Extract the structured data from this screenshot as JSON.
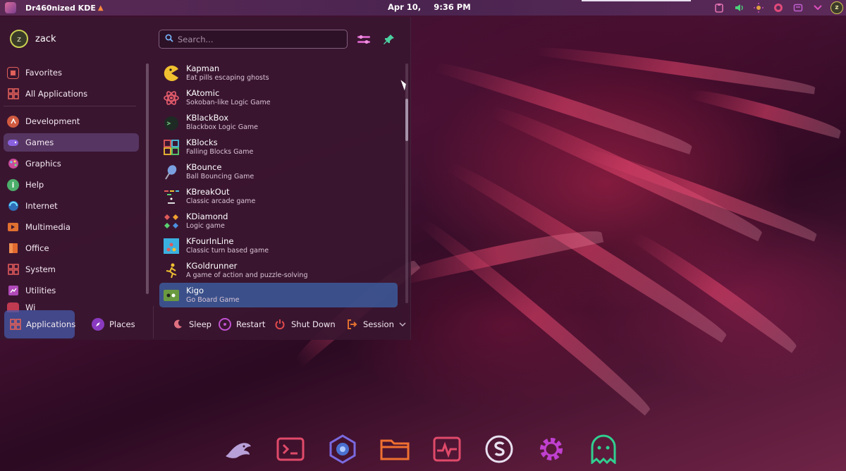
{
  "top_panel": {
    "title": "Dr460nized KDE",
    "date": "Apr 10,",
    "time": "9:36 PM",
    "avatar_initial": "z"
  },
  "menu": {
    "user": {
      "initial": "z",
      "name": "zack"
    },
    "search": {
      "placeholder": "Search...",
      "value": ""
    },
    "categories": [
      {
        "label": "Favorites",
        "icon": "star-icon",
        "color": "#e0605a"
      },
      {
        "label": "All Applications",
        "icon": "grid-icon",
        "color": "#e0605a"
      },
      {
        "label": "Development",
        "icon": "development-icon",
        "color": "#d05a40"
      },
      {
        "label": "Games",
        "icon": "games-icon",
        "color": "#7b5cd6"
      },
      {
        "label": "Graphics",
        "icon": "graphics-icon",
        "color": "#c84a9a"
      },
      {
        "label": "Help",
        "icon": "help-icon",
        "color": "#4cae6a"
      },
      {
        "label": "Internet",
        "icon": "internet-icon",
        "color": "#3c8ed8"
      },
      {
        "label": "Multimedia",
        "icon": "multimedia-icon",
        "color": "#e07030"
      },
      {
        "label": "Office",
        "icon": "office-icon",
        "color": "#e06a30"
      },
      {
        "label": "System",
        "icon": "system-icon",
        "color": "#e05a5a"
      },
      {
        "label": "Utilities",
        "icon": "utilities-icon",
        "color": "#b04ab8"
      },
      {
        "label": "Wi",
        "icon": "wine-icon",
        "color": "#c03a50"
      }
    ],
    "apps": [
      {
        "name": "Kapman",
        "desc": "Eat pills escaping ghosts",
        "icon": "kapman-icon"
      },
      {
        "name": "KAtomic",
        "desc": "Sokoban-like Logic Game",
        "icon": "katomic-icon"
      },
      {
        "name": "KBlackBox",
        "desc": "Blackbox Logic Game",
        "icon": "kblackbox-icon"
      },
      {
        "name": "KBlocks",
        "desc": "Falling Blocks Game",
        "icon": "kblocks-icon"
      },
      {
        "name": "KBounce",
        "desc": "Ball Bouncing Game",
        "icon": "kbounce-icon"
      },
      {
        "name": "KBreakOut",
        "desc": "Classic arcade game",
        "icon": "kbreakout-icon"
      },
      {
        "name": "KDiamond",
        "desc": "Logic game",
        "icon": "kdiamond-icon"
      },
      {
        "name": "KFourInLine",
        "desc": "Classic turn based game",
        "icon": "kfourinline-icon"
      },
      {
        "name": "KGoldrunner",
        "desc": "A game of action and puzzle-solving",
        "icon": "kgoldrunner-icon"
      },
      {
        "name": "Kigo",
        "desc": "Go Board Game",
        "icon": "kigo-icon"
      }
    ],
    "footer": {
      "applications": "Applications",
      "places": "Places",
      "sleep": "Sleep",
      "restart": "Restart",
      "shutdown": "Shut Down",
      "session": "Session"
    }
  },
  "dock": [
    {
      "icon": "dragon-icon"
    },
    {
      "icon": "terminal-icon"
    },
    {
      "icon": "browser-icon"
    },
    {
      "icon": "folder-icon"
    },
    {
      "icon": "system-monitor-icon"
    },
    {
      "icon": "store-icon"
    },
    {
      "icon": "settings-icon"
    },
    {
      "icon": "ghost-icon"
    }
  ]
}
